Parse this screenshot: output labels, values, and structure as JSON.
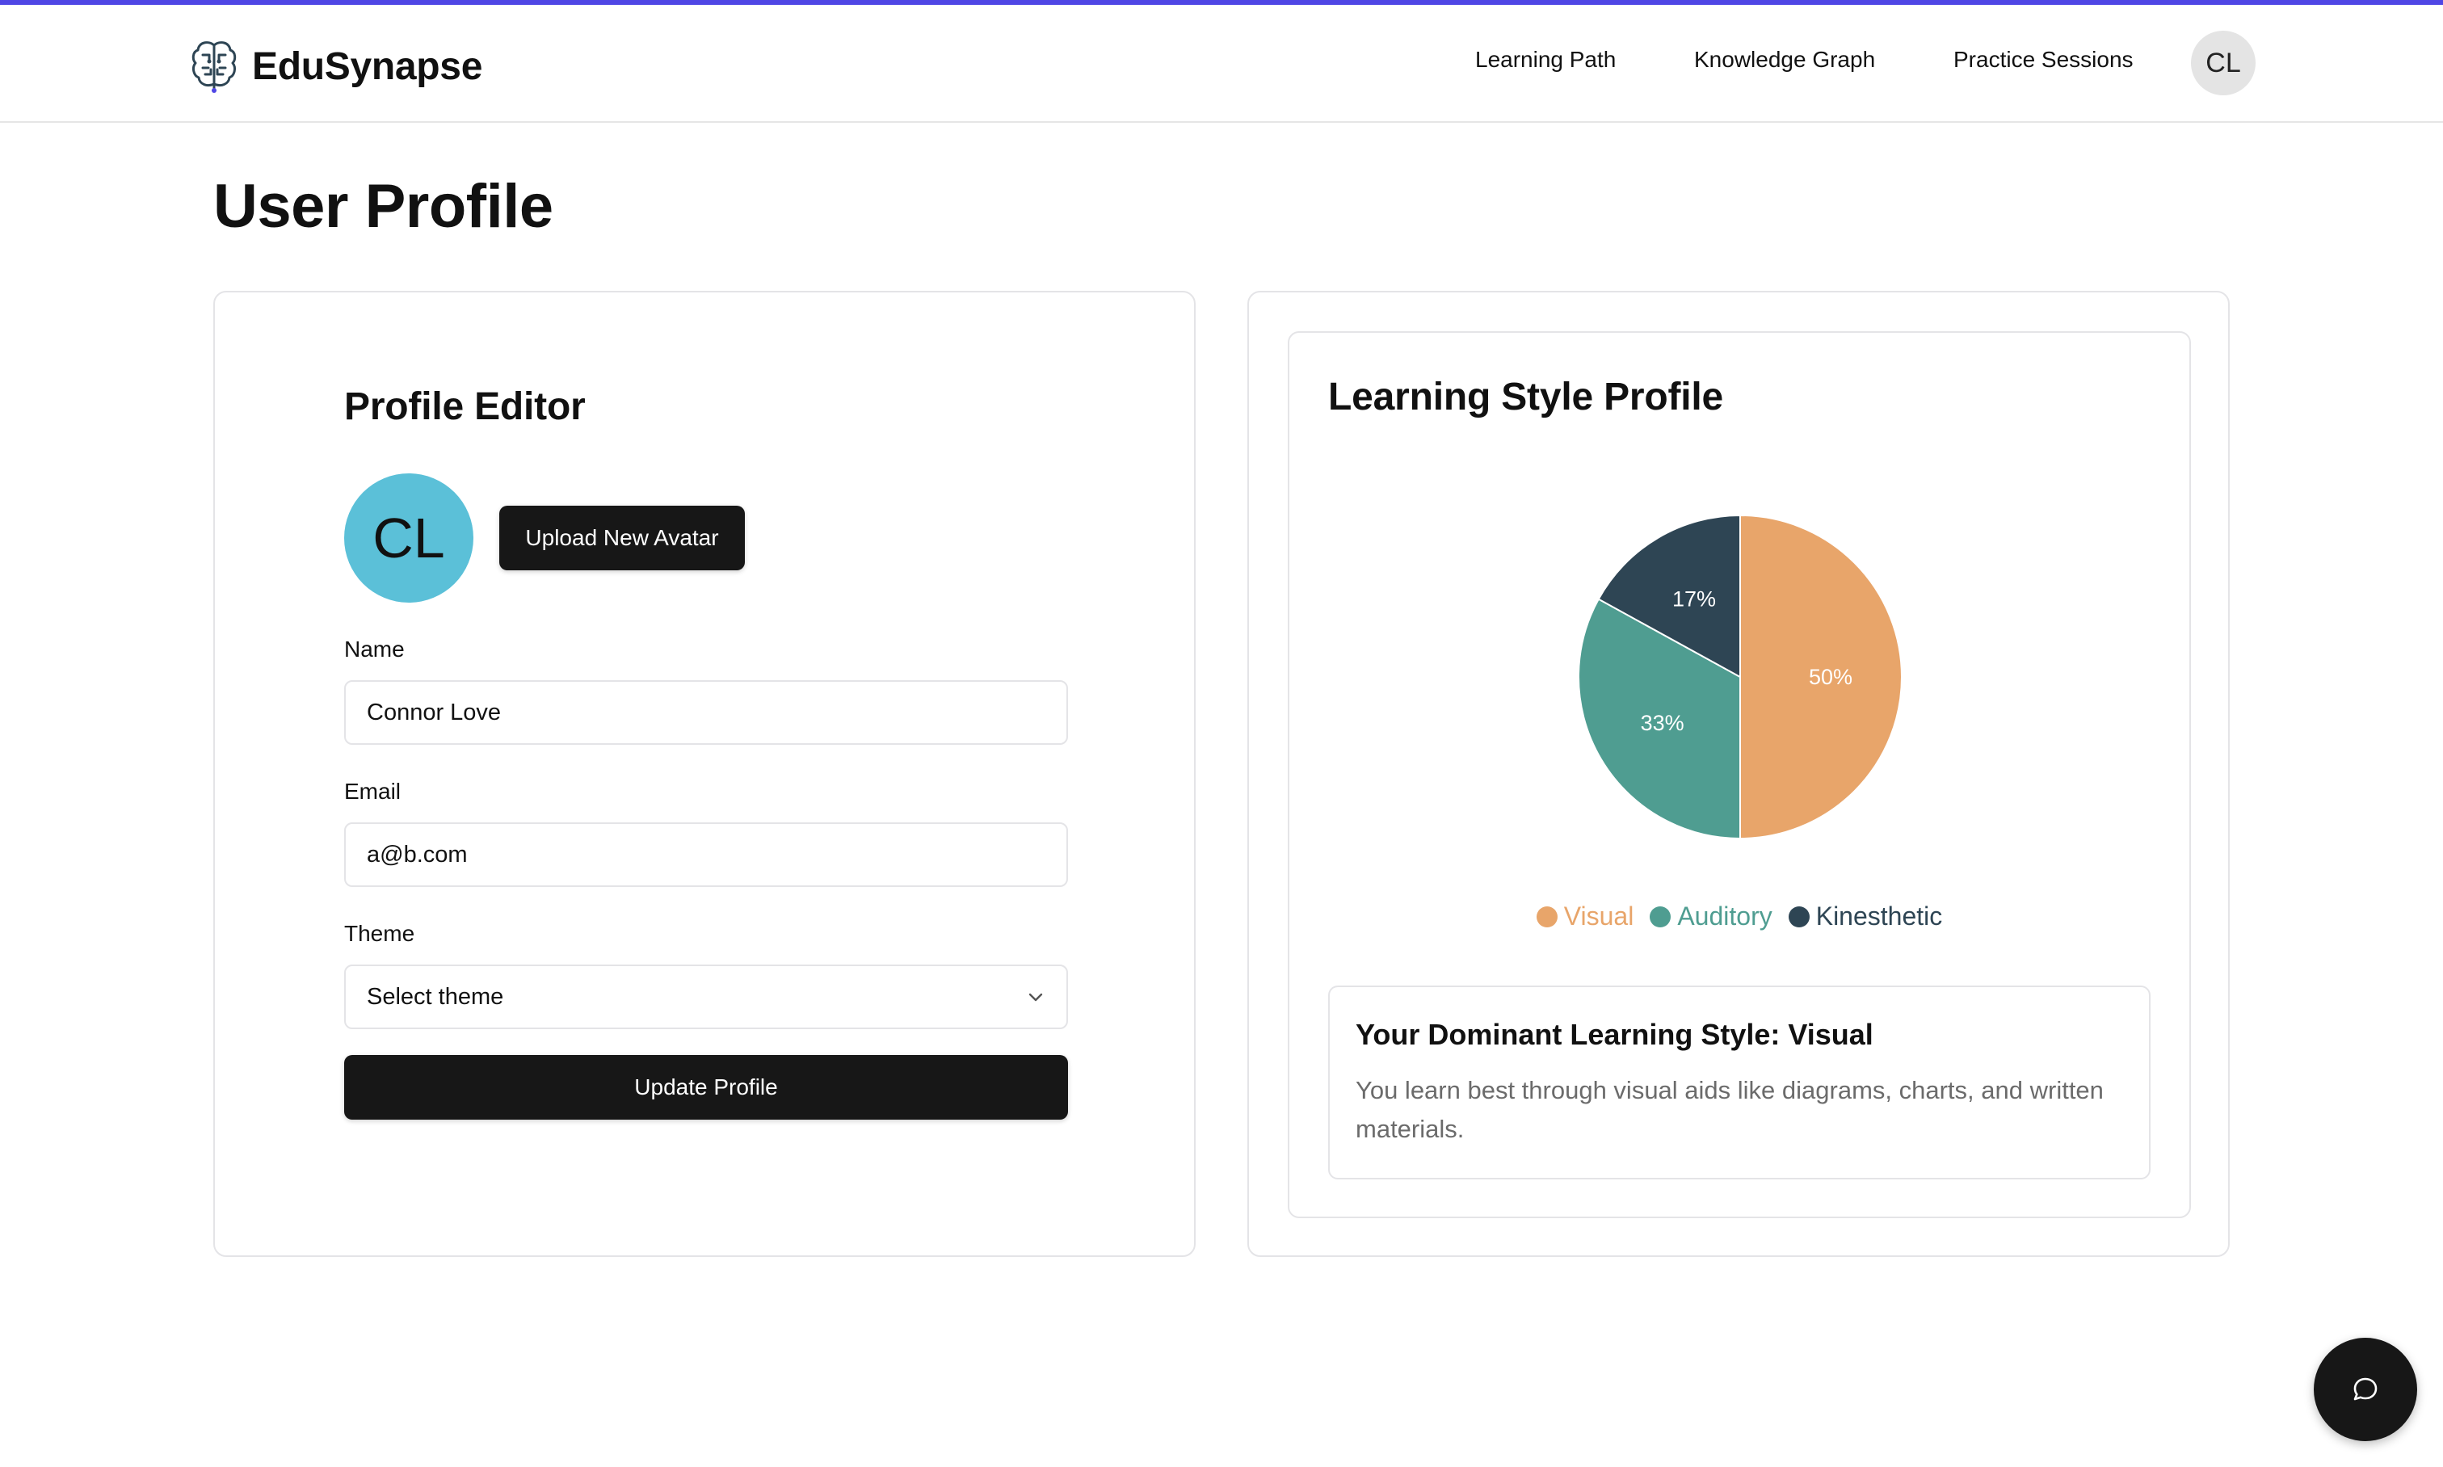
{
  "app": {
    "name": "EduSynapse",
    "accent_color": "#4f46e5"
  },
  "nav": {
    "links": [
      "Learning Path",
      "Knowledge Graph",
      "Practice Sessions"
    ],
    "avatar_initials": "CL"
  },
  "page": {
    "title": "User Profile"
  },
  "profile_editor": {
    "title": "Profile Editor",
    "avatar_initials": "CL",
    "avatar_color": "#5bc0d8",
    "upload_label": "Upload New Avatar",
    "name_label": "Name",
    "name_value": "Connor Love",
    "email_label": "Email",
    "email_value": "a@b.com",
    "theme_label": "Theme",
    "theme_value": "Select theme",
    "update_label": "Update Profile"
  },
  "learning_style": {
    "title": "Learning Style Profile",
    "dominant_title": "Your Dominant Learning Style: Visual",
    "dominant_text": "You learn best through visual aids like diagrams, charts, and written materials."
  },
  "chart_data": {
    "type": "pie",
    "categories": [
      "Visual",
      "Auditory",
      "Kinesthetic"
    ],
    "values": [
      50,
      33,
      17
    ],
    "labels": [
      "50%",
      "33%",
      "17%"
    ],
    "colors": [
      "#e8a56a",
      "#4f9d91",
      "#2e4554"
    ],
    "legend": "bottom"
  },
  "icons": {
    "brand": "brain-icon",
    "chat": "chat-bubble-icon",
    "select": "chevron-down-icon"
  }
}
